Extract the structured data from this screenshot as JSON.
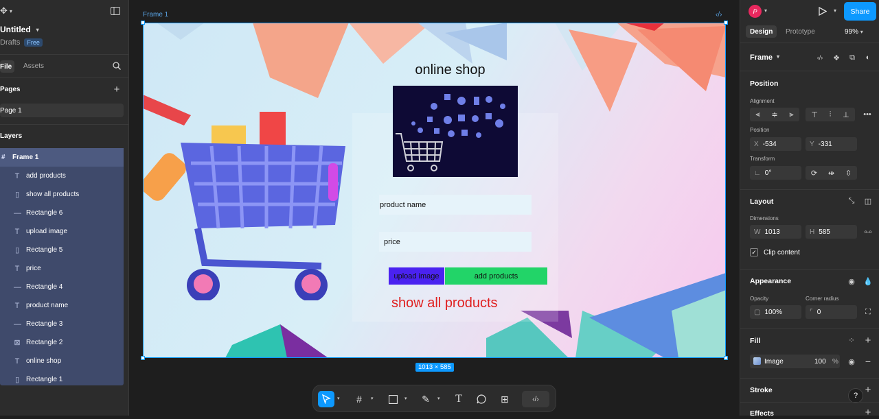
{
  "app": {
    "file_name": "Untitled",
    "project": "Drafts",
    "plan_badge": "Free"
  },
  "left": {
    "tabs": [
      "File",
      "Assets"
    ],
    "pages_title": "Pages",
    "page_item": "Page 1",
    "layers_title": "Layers",
    "frame_layer": "Frame 1",
    "layers": [
      {
        "name": "add products",
        "icon": "text-icon"
      },
      {
        "name": "show all products",
        "icon": "rectangle-icon"
      },
      {
        "name": "Rectangle 6",
        "icon": "line-icon"
      },
      {
        "name": "upload image",
        "icon": "text-icon"
      },
      {
        "name": "Rectangle 5",
        "icon": "rectangle-icon"
      },
      {
        "name": "price",
        "icon": "text-icon"
      },
      {
        "name": "Rectangle 4",
        "icon": "line-icon"
      },
      {
        "name": "product name",
        "icon": "text-icon"
      },
      {
        "name": "Rectangle 3",
        "icon": "line-icon"
      },
      {
        "name": "Rectangle 2",
        "icon": "image-icon"
      },
      {
        "name": "online shop",
        "icon": "text-icon"
      },
      {
        "name": "Rectangle 1",
        "icon": "rectangle-icon"
      }
    ]
  },
  "canvas": {
    "frame_label": "Frame 1",
    "size_badge": "1013 × 585",
    "design": {
      "title": "online shop",
      "input_product_name": "product name",
      "input_price": "price",
      "btn_upload": "upload image",
      "btn_add": "add products",
      "link_show_all": "show all products"
    }
  },
  "right": {
    "avatar_initial": "P",
    "share_label": "Share",
    "tabs": [
      "Design",
      "Prototype"
    ],
    "zoom": "99%",
    "selection": "Frame",
    "position_title": "Position",
    "alignment_label": "Alignment",
    "position_label": "Position",
    "x_key": "X",
    "x_value": "-534",
    "y_key": "Y",
    "y_value": "-331",
    "transform_label": "Transform",
    "rotation": "0°",
    "layout_title": "Layout",
    "dimensions_label": "Dimensions",
    "w_key": "W",
    "w_value": "1013",
    "h_key": "H",
    "h_value": "585",
    "clip_content": "Clip content",
    "appearance_title": "Appearance",
    "opacity_label": "Opacity",
    "opacity_value": "100%",
    "radius_label": "Corner radius",
    "radius_value": "0",
    "fill_title": "Fill",
    "fill_type": "Image",
    "fill_opacity": "100",
    "fill_percent": "%",
    "stroke_title": "Stroke",
    "effects_title": "Effects",
    "help": "?"
  },
  "colors": {
    "accent": "#0d99ff",
    "upload_button": "#4a22f0",
    "add_button": "#22d468",
    "show_all_link": "#e02020",
    "avatar": "#e8285e"
  }
}
